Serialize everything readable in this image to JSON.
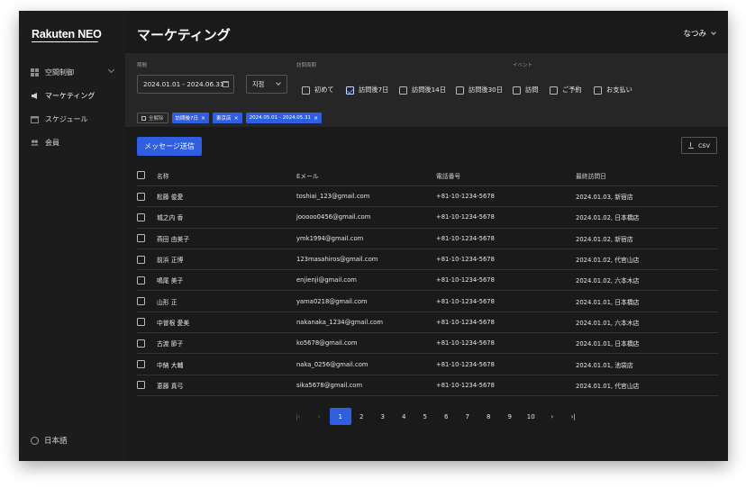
{
  "sidebar": {
    "logo": "Rakuten NEO",
    "items": [
      {
        "label": "空間制御",
        "icon": "grid-icon"
      },
      {
        "label": "マーケティング",
        "icon": "megaphone-icon"
      },
      {
        "label": "スケジュール",
        "icon": "calendar-icon"
      },
      {
        "label": "会員",
        "icon": "people-icon"
      }
    ],
    "language": "日本語"
  },
  "header": {
    "title": "マーケティング",
    "user": "なつみ"
  },
  "filters": {
    "period_label": "期間",
    "date_range": "2024.01.01 - 2024.06.31",
    "store_select": "지점",
    "visit_cycle_label": "訪問周期",
    "visit_cycle": [
      {
        "label": "初めて",
        "checked": false
      },
      {
        "label": "訪問後7日",
        "checked": true
      },
      {
        "label": "訪問後14日",
        "checked": false
      },
      {
        "label": "訪問後30日",
        "checked": false
      }
    ],
    "event_label": "イベント",
    "events": [
      {
        "label": "訪問",
        "checked": false
      },
      {
        "label": "ご予約",
        "checked": false
      },
      {
        "label": "お支払い",
        "checked": false
      }
    ],
    "clear_all": "全解除",
    "chips": [
      "訪問後7日",
      "東京店",
      "2024.05.01 - 2024.05.31"
    ]
  },
  "actions": {
    "send_message": "メッセージ送信",
    "csv": "CSV"
  },
  "table": {
    "headers": [
      "名称",
      "Eメール",
      "電話番号",
      "最終訪問日"
    ],
    "rows": [
      [
        "松藤 俊愛",
        "toshiai_123@gmail.com",
        "+81-10-1234-5678",
        "2024.01.03, 新宿店"
      ],
      [
        "城之内 香",
        "jooooo0456@gmail.com",
        "+81-10-1234-5678",
        "2024.01.02, 日本橋店"
      ],
      [
        "燕田 由美子",
        "ymk1994@gmail.com",
        "+81-10-1234-5678",
        "2024.01.02, 新宿店"
      ],
      [
        "前浜 正博",
        "123masahiros@gmail.com",
        "+81-10-1234-5678",
        "2024.01.02, 代官山店"
      ],
      [
        "鳴尾 美子",
        "enjienji@gmail.com",
        "+81-10-1234-5678",
        "2024.01.02, 六本木店"
      ],
      [
        "山形 正",
        "yama0218@gmail.com",
        "+81-10-1234-5678",
        "2024.01.01, 日本橋店"
      ],
      [
        "中曽根 愛美",
        "nakanaka_1234@gmail.com",
        "+81-10-1234-5678",
        "2024.01.01, 六本木店"
      ],
      [
        "古渡 節子",
        "ko5678@gmail.com",
        "+81-10-1234-5678",
        "2024.01.01, 日本橋店"
      ],
      [
        "中納 大輔",
        "naka_0256@gmail.com",
        "+81-10-1234-5678",
        "2024.01.01, 池袋店"
      ],
      [
        "恵藤 真弓",
        "sika5678@gmail.com",
        "+81-10-1234-5678",
        "2024.01.01, 代官山店"
      ]
    ]
  },
  "pagination": {
    "first": "|‹",
    "prev": "‹",
    "pages": [
      "1",
      "2",
      "3",
      "4",
      "5",
      "6",
      "7",
      "8",
      "9",
      "10"
    ],
    "current": "1",
    "next": "›",
    "last": "›|"
  },
  "colors": {
    "accent": "#2f5fe0",
    "background": "#1a1a1a",
    "panel": "#262626"
  }
}
